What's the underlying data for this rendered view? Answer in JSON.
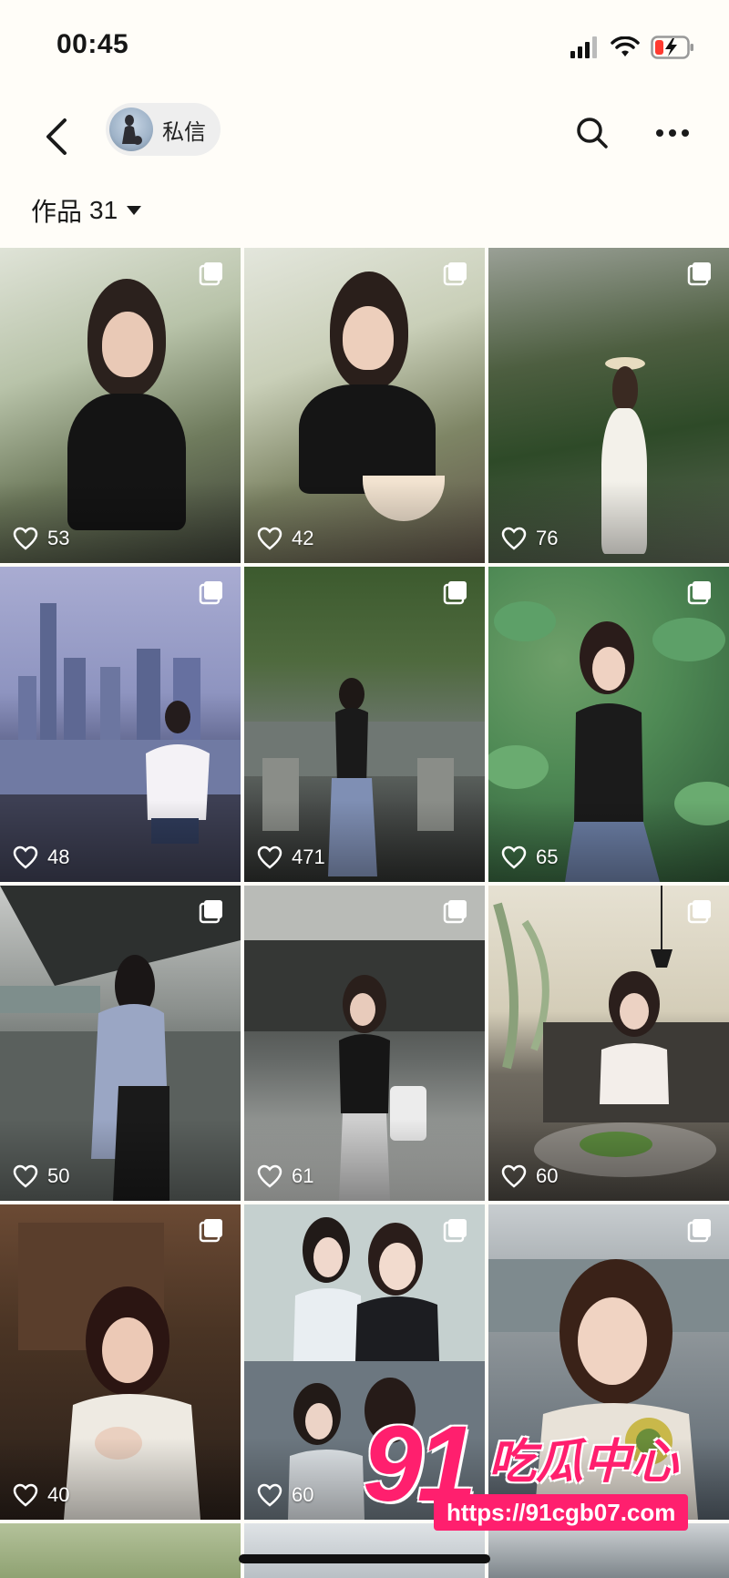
{
  "status_bar": {
    "time": "00:45"
  },
  "nav": {
    "dm_label": "私信"
  },
  "works": {
    "label": "作品",
    "count": "31"
  },
  "posts": [
    {
      "likes": "53"
    },
    {
      "likes": "42"
    },
    {
      "likes": "76"
    },
    {
      "likes": "48"
    },
    {
      "likes": "471"
    },
    {
      "likes": "65"
    },
    {
      "likes": "50"
    },
    {
      "likes": "61"
    },
    {
      "likes": "60"
    },
    {
      "likes": "40"
    },
    {
      "likes": "60"
    },
    {
      "likes": ""
    }
  ],
  "watermark": {
    "number": "91",
    "text": "吃瓜中心",
    "url": "https://91cgb07.com"
  },
  "colors": {
    "accent": "#ff1f6e",
    "background": "#fffdf8",
    "chip": "#eeeeee"
  }
}
